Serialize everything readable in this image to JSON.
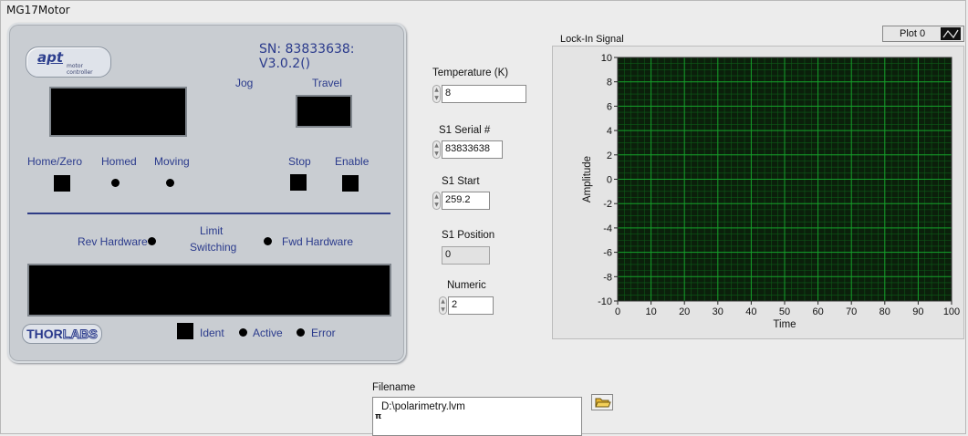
{
  "window": {
    "title": "MG17Motor"
  },
  "apt_panel": {
    "logo": "apt",
    "logo_sub": "motor controller",
    "serial": "SN: 83833638: V3.0.2()",
    "jog_label": "Jog",
    "travel_label": "Travel",
    "home_label": "Home/Zero",
    "homed_label": "Homed",
    "moving_label": "Moving",
    "stop_label": "Stop",
    "enable_label": "Enable",
    "rev_label": "Rev Hardware",
    "limit_label_1": "Limit",
    "limit_label_2": "Switching",
    "fwd_label": "Fwd Hardware",
    "brand": "THORLABS",
    "brand_a": "THOR",
    "brand_b": "LABS",
    "ident_label": "Ident",
    "active_label": "Active",
    "error_label": "Error"
  },
  "controls": {
    "temperature": {
      "label": "Temperature (K)",
      "value": "8"
    },
    "serial": {
      "label": "S1 Serial #",
      "value": "83833638"
    },
    "start": {
      "label": "S1 Start",
      "value": "259.2"
    },
    "position": {
      "label": "S1 Position",
      "value": "0"
    },
    "numeric": {
      "label": "Numeric",
      "value": "2"
    }
  },
  "colors": {
    "plot_bg": "#0b1f0b",
    "grid_major": "#16a02b",
    "grid_minor": "#0d5c18",
    "panel": "#c9cdd2",
    "label_blue": "#2a3a8c"
  },
  "chart_data": {
    "type": "line",
    "title": "Lock-In Signal",
    "xlabel": "Time",
    "ylabel": "Amplitude",
    "xlim": [
      0,
      100
    ],
    "ylim": [
      -10,
      10
    ],
    "x_ticks": [
      0,
      10,
      20,
      30,
      40,
      50,
      60,
      70,
      80,
      90,
      100
    ],
    "y_ticks": [
      10,
      8,
      6,
      4,
      2,
      0,
      -2,
      -4,
      -6,
      -8,
      -10
    ],
    "grid": true,
    "legend_position": "top-right",
    "series": [
      {
        "name": "Plot 0",
        "values": []
      }
    ]
  },
  "file": {
    "label": "Filename",
    "value": "D:\\polarimetry.lvm"
  }
}
